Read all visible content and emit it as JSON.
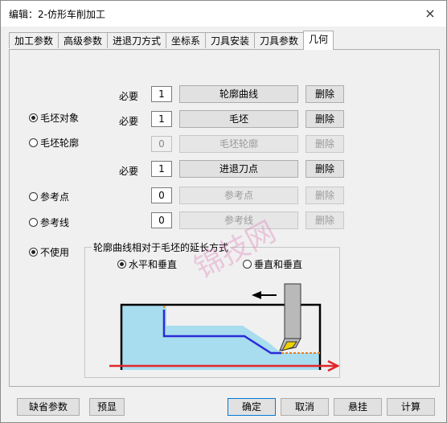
{
  "window": {
    "title": "编辑：2-仿形车削加工",
    "close_glyph": "×"
  },
  "tabs": [
    "加工参数",
    "高级参数",
    "进退刀方式",
    "坐标系",
    "刀具安装",
    "刀具参数",
    "几何"
  ],
  "rows": [
    {
      "required": "必要",
      "count": "1",
      "button": "轮廓曲线",
      "delete": "删除"
    },
    {
      "required": "必要",
      "count": "1",
      "button": "毛坯",
      "delete": "删除"
    },
    {
      "required": "",
      "count": "0",
      "button": "毛坯轮廓",
      "delete": "删除"
    },
    {
      "required": "必要",
      "count": "1",
      "button": "进退刀点",
      "delete": "删除"
    },
    {
      "required": "",
      "count": "0",
      "button": "参考点",
      "delete": "删除"
    },
    {
      "required": "",
      "count": "0",
      "button": "参考线",
      "delete": "删除"
    }
  ],
  "radios": {
    "blank_object": "毛坯对象",
    "blank_contour": "毛坯轮廓",
    "ref_point": "参考点",
    "ref_line": "参考线",
    "not_use": "不使用",
    "selected_left": "毛坯对象"
  },
  "extension": {
    "title": "轮廓曲线相对于毛坯的延长方式",
    "option1": "水平和垂直",
    "option2": "垂直和垂直",
    "selected": "水平和垂直"
  },
  "watermark": "锦技网",
  "bottom_buttons": {
    "defaults": "缺省参数",
    "preview": "预显",
    "ok": "确定",
    "cancel": "取消",
    "suspend": "悬挂",
    "calculate": "计算"
  },
  "colors": {
    "stock_fill": "#a8dcef",
    "contour": "#2b2bd6",
    "arrow_red": "#e0262a",
    "dash_orange": "#e8801e",
    "tool_gray": "#b9b9b9",
    "insert_yellow": "#f0d000"
  }
}
